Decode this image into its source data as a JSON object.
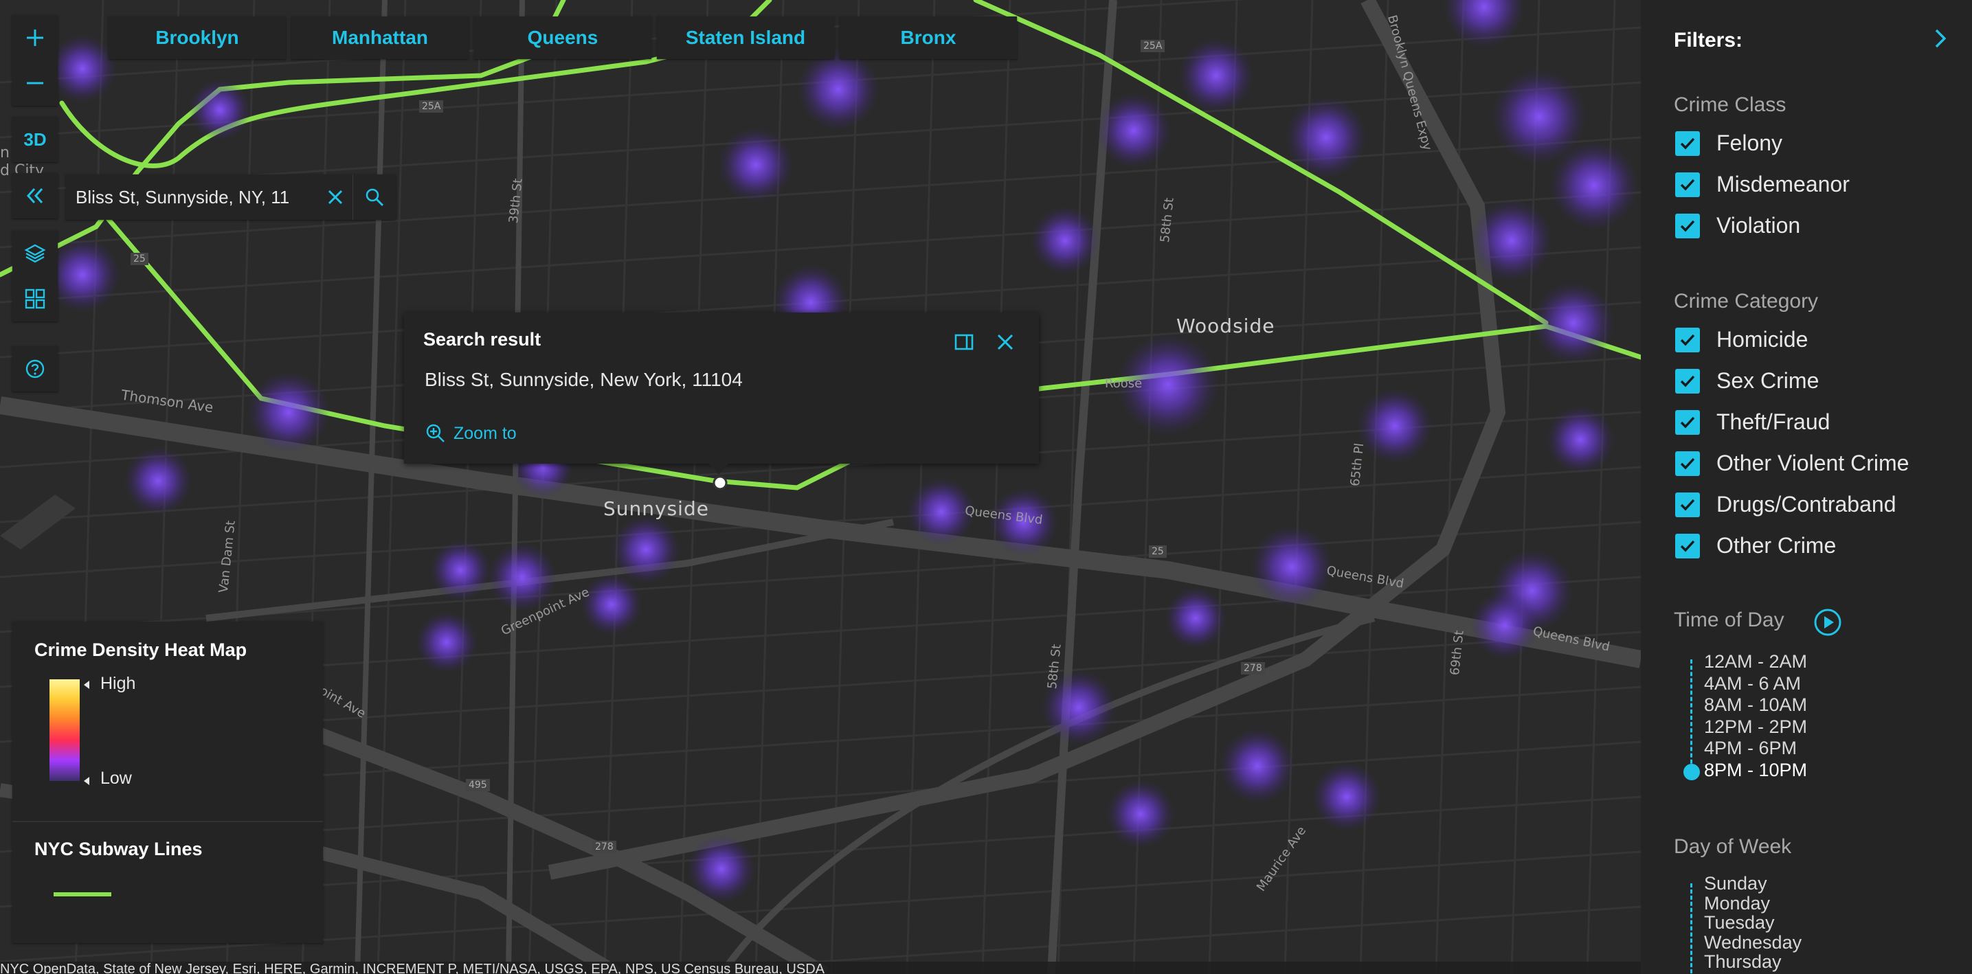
{
  "map": {
    "place_labels": {
      "woodside": "Woodside",
      "sunnyside": "Sunnyside"
    },
    "street_labels": {
      "thomson_ave": "Thomson Ave",
      "van_dam_st": "Van Dam St",
      "greenpoint_ave": "Greenpoint Ave",
      "st_39th": "39th St",
      "st_58th_north": "58th St",
      "st_58th_south": "58th St",
      "pl_65th": "65th Pl",
      "st_69th": "69th St",
      "maurice_ave": "Maurice Ave",
      "queens_blvd_1": "Queens Blvd",
      "queens_blvd_2": "Queens Blvd",
      "queens_blvd_3": "Queens Blvd",
      "bqe": "Brooklyn Queens Expy",
      "point_ave": "oint Ave",
      "roosevelt": "Roose",
      "city_fragment": "n\nd City"
    },
    "route_shields": {
      "r25a": "25A",
      "r25a_west": "25A",
      "r25": "25",
      "r278_east": "278",
      "r278_south": "278",
      "r495": "495",
      "r25_small": "25"
    }
  },
  "boroughs": [
    "Brooklyn",
    "Manhattan",
    "Queens",
    "Staten Island",
    "Bronx"
  ],
  "toolbar": {
    "zoom_in": "+",
    "zoom_out": "—",
    "view_3d": "3D"
  },
  "search": {
    "value": "Bliss St, Sunnyside, NY, 11"
  },
  "popup": {
    "title": "Search result",
    "address": "Bliss St, Sunnyside, New York, 11104",
    "zoom_to": "Zoom to"
  },
  "legend": {
    "heatmap_title": "Crime Density Heat Map",
    "high": "High",
    "low": "Low",
    "subway_title": "NYC Subway Lines",
    "colors": {
      "subway_line": "#8be04e",
      "heat_low": "#3c2f6a",
      "heat_high": "#fff59a"
    }
  },
  "attribution": "NYC OpenData, State of New Jersey, Esri, HERE, Garmin, INCREMENT P, METI/NASA, USGS, EPA, NPS, US Census Bureau, USDA",
  "filters": {
    "title": "Filters:",
    "accent_color": "#21c4e6",
    "crime_class": {
      "title": "Crime Class",
      "items": [
        "Felony",
        "Misdemeanor",
        "Violation"
      ]
    },
    "crime_category": {
      "title": "Crime Category",
      "items": [
        "Homicide",
        "Sex Crime",
        "Theft/Fraud",
        "Other Violent Crime",
        "Drugs/Contraband",
        "Other Crime"
      ]
    },
    "time_of_day": {
      "title": "Time of Day",
      "options": [
        "12AM - 2AM",
        "4AM - 6 AM",
        "8AM - 10AM",
        "12PM - 2PM",
        "4PM - 6PM",
        "8PM - 10PM"
      ],
      "selected": "8PM - 10PM"
    },
    "day_of_week": {
      "title": "Day of Week",
      "options": [
        "Sunday",
        "Monday",
        "Tuesday",
        "Wednesday",
        "Thursday"
      ]
    }
  }
}
